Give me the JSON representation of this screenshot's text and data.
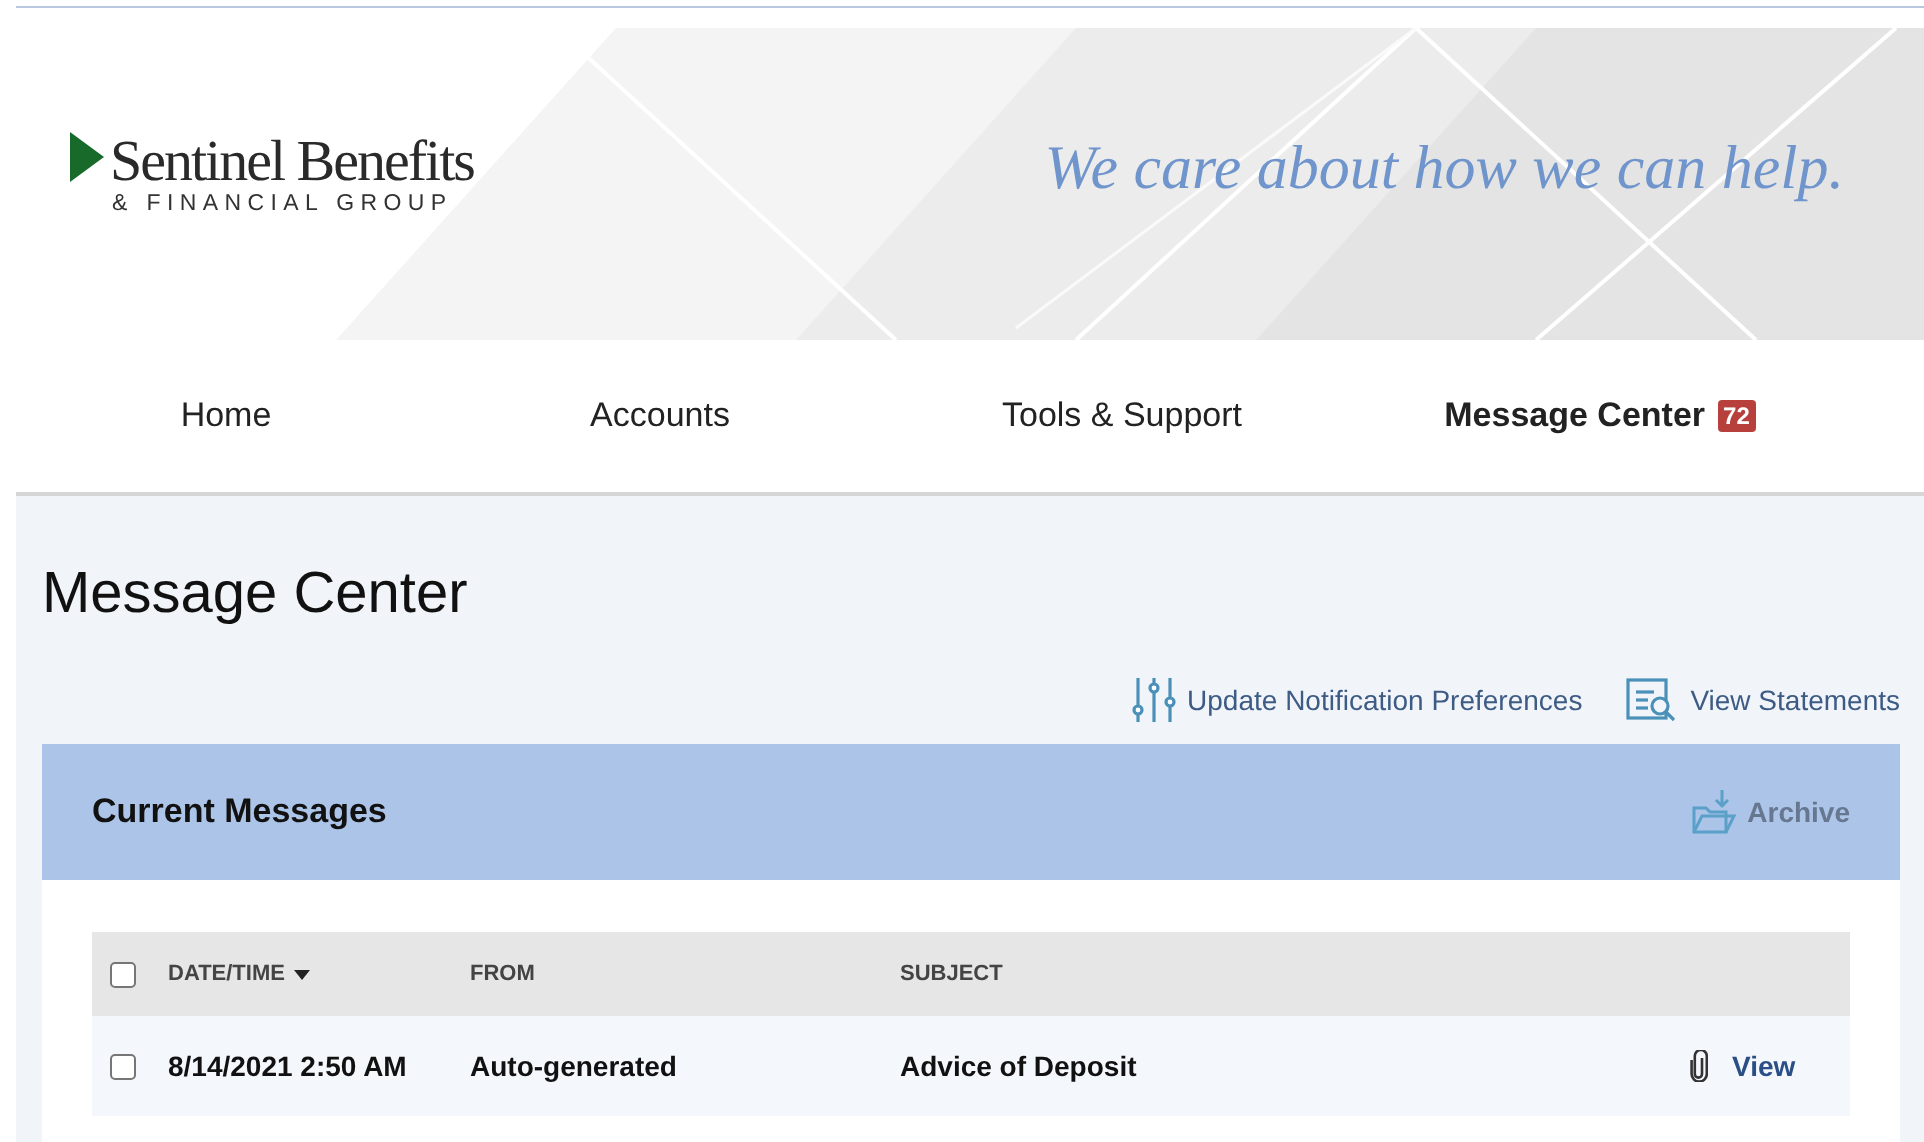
{
  "logo": {
    "name": "Sentinel Benefits",
    "subtitle": "& FINANCIAL GROUP"
  },
  "tagline": "We care about how we can help.",
  "nav": [
    {
      "label": "Home",
      "selected": false
    },
    {
      "label": "Accounts",
      "selected": false
    },
    {
      "label": "Tools & Support",
      "selected": false
    },
    {
      "label": "Message Center",
      "selected": true,
      "badge": "72"
    }
  ],
  "page_title": "Message Center",
  "actions": [
    {
      "kind": "preferences",
      "label": "Update Notification Preferences"
    },
    {
      "kind": "statements",
      "label": "View Statements"
    }
  ],
  "panel": {
    "title": "Current Messages",
    "archive": {
      "label": "Archive",
      "disabled": true
    }
  },
  "table": {
    "select_all": {
      "checked": false
    },
    "columns": [
      {
        "label": "DATE/TIME",
        "sorted": true
      },
      {
        "label": "FROM",
        "sorted": false
      },
      {
        "label": "SUBJECT",
        "sorted": false
      }
    ],
    "rows": [
      {
        "checked": false,
        "date": "8/14/2021 2:50 AM",
        "from": "Auto-generated",
        "subject": "Advice of Deposit",
        "attachment": true,
        "action": "View"
      }
    ]
  }
}
